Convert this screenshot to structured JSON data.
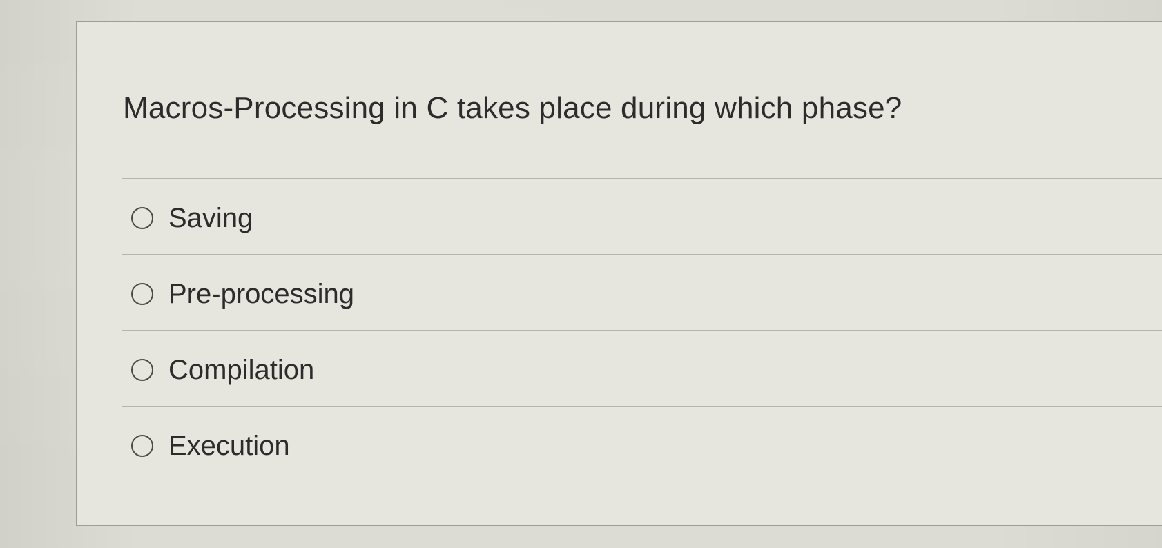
{
  "quiz": {
    "question": "Macros-Processing in C takes place during which phase?",
    "options": [
      {
        "label": "Saving",
        "selected": false
      },
      {
        "label": "Pre-processing",
        "selected": false
      },
      {
        "label": "Compilation",
        "selected": false
      },
      {
        "label": "Execution",
        "selected": false
      }
    ]
  }
}
